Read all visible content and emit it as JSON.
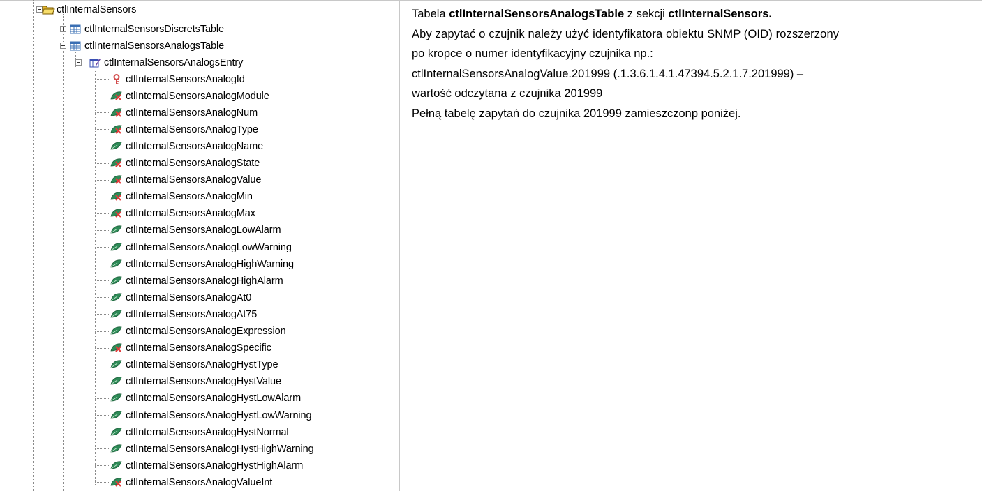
{
  "tree": {
    "root": {
      "label": "ctlInternalSensors",
      "icon": "open-folder-icon"
    },
    "tables": [
      {
        "label": "ctlInternalSensorsDiscretsTable",
        "icon": "table-icon",
        "expanded": false
      },
      {
        "label": "ctlInternalSensorsAnalogsTable",
        "icon": "table-icon",
        "expanded": true
      }
    ],
    "entry": {
      "label": "ctlInternalSensorsAnalogsEntry",
      "icon": "table-entry-icon"
    },
    "leaves": [
      {
        "label": "ctlInternalSensorsAnalogId",
        "icon": "key-icon"
      },
      {
        "label": "ctlInternalSensorsAnalogModule",
        "icon": "leaf-readonly-icon"
      },
      {
        "label": "ctlInternalSensorsAnalogNum",
        "icon": "leaf-readonly-icon"
      },
      {
        "label": "ctlInternalSensorsAnalogType",
        "icon": "leaf-readonly-icon"
      },
      {
        "label": "ctlInternalSensorsAnalogName",
        "icon": "leaf-icon"
      },
      {
        "label": "ctlInternalSensorsAnalogState",
        "icon": "leaf-readonly-icon"
      },
      {
        "label": "ctlInternalSensorsAnalogValue",
        "icon": "leaf-readonly-icon"
      },
      {
        "label": "ctlInternalSensorsAnalogMin",
        "icon": "leaf-readonly-icon"
      },
      {
        "label": "ctlInternalSensorsAnalogMax",
        "icon": "leaf-readonly-icon"
      },
      {
        "label": "ctlInternalSensorsAnalogLowAlarm",
        "icon": "leaf-icon"
      },
      {
        "label": "ctlInternalSensorsAnalogLowWarning",
        "icon": "leaf-icon"
      },
      {
        "label": "ctlInternalSensorsAnalogHighWarning",
        "icon": "leaf-icon"
      },
      {
        "label": "ctlInternalSensorsAnalogHighAlarm",
        "icon": "leaf-icon"
      },
      {
        "label": "ctlInternalSensorsAnalogAt0",
        "icon": "leaf-icon"
      },
      {
        "label": "ctlInternalSensorsAnalogAt75",
        "icon": "leaf-icon"
      },
      {
        "label": "ctlInternalSensorsAnalogExpression",
        "icon": "leaf-icon"
      },
      {
        "label": "ctlInternalSensorsAnalogSpecific",
        "icon": "leaf-readonly-icon"
      },
      {
        "label": "ctlInternalSensorsAnalogHystType",
        "icon": "leaf-icon"
      },
      {
        "label": "ctlInternalSensorsAnalogHystValue",
        "icon": "leaf-icon"
      },
      {
        "label": "ctlInternalSensorsAnalogHystLowAlarm",
        "icon": "leaf-icon"
      },
      {
        "label": "ctlInternalSensorsAnalogHystLowWarning",
        "icon": "leaf-icon"
      },
      {
        "label": "ctlInternalSensorsAnalogHystNormal",
        "icon": "leaf-icon"
      },
      {
        "label": "ctlInternalSensorsAnalogHystHighWarning",
        "icon": "leaf-icon"
      },
      {
        "label": "ctlInternalSensorsAnalogHystHighAlarm",
        "icon": "leaf-icon"
      },
      {
        "label": "ctlInternalSensorsAnalogValueInt",
        "icon": "leaf-readonly-icon"
      }
    ]
  },
  "description": {
    "line1": {
      "prefix": "Tabela ",
      "table_name": "ctlInternalSensorsAnalogsTable",
      "middle": " z sekcji ",
      "section_name": "ctlInternalSensors."
    },
    "line2": "Aby zapytać o czujnik należy użyć identyfikatora obiektu SNMP (OID) rozszerzony",
    "line3": "po kropce o numer identyfikacyjny czujnika np.:",
    "line4": "ctlInternalSensorsAnalogValue.201999 (.1.3.6.1.4.1.47394.5.2.1.7.201999) –",
    "line5": "wartość odczytana z czujnika 201999",
    "line6": "Pełną tabelę zapytań do czujnika 201999 zamieszczonp poniżej."
  },
  "colors": {
    "grid": "#c8c8c8",
    "folder": "#f2c94c",
    "table": "#3a6fb3",
    "leaf": "#2e8b57",
    "readonly_x": "#e03b3b",
    "key": "#d24b4b"
  }
}
